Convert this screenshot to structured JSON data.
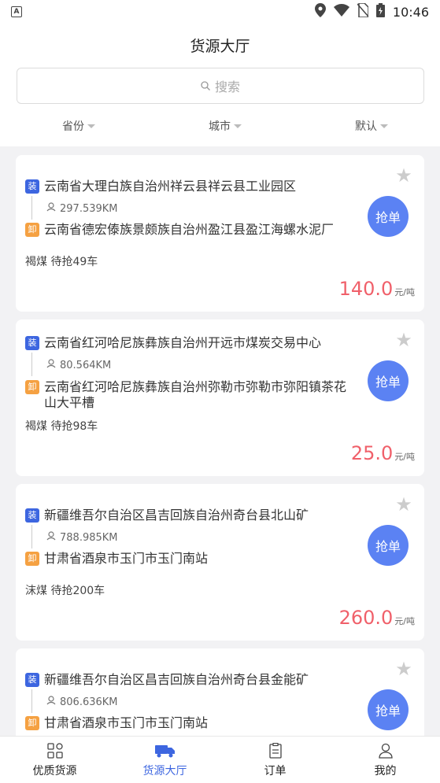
{
  "status_bar": {
    "left_icon": "A",
    "time": "10:46",
    "icons": [
      "location-icon",
      "wifi-icon",
      "no-sim-icon",
      "battery-icon"
    ]
  },
  "header": {
    "title": "货源大厅",
    "search_placeholder": "搜索"
  },
  "filters": [
    {
      "label": "省份"
    },
    {
      "label": "城市"
    },
    {
      "label": "默认"
    }
  ],
  "cards": [
    {
      "load_tag": "装",
      "load_address": "云南省大理白族自治州祥云县祥云县工业园区",
      "distance": "297.539KM",
      "unload_tag": "卸",
      "unload_address": "云南省德宏傣族景颇族自治州盈江县盈江海螺水泥厂",
      "cargo": "褐煤  待抢49车",
      "price": "140.0",
      "unit": "元/吨",
      "grab_label": "抢单"
    },
    {
      "load_tag": "装",
      "load_address": "云南省红河哈尼族彝族自治州开远市煤炭交易中心",
      "distance": "80.564KM",
      "unload_tag": "卸",
      "unload_address": "云南省红河哈尼族彝族自治州弥勒市弥勒市弥阳镇茶花山大平槽",
      "cargo": "褐煤  待抢98车",
      "price": "25.0",
      "unit": "元/吨",
      "grab_label": "抢单"
    },
    {
      "load_tag": "装",
      "load_address": "新疆维吾尔自治区昌吉回族自治州奇台县北山矿",
      "distance": "788.985KM",
      "unload_tag": "卸",
      "unload_address": "甘肃省酒泉市玉门市玉门南站",
      "cargo": "沫煤  待抢200车",
      "price": "260.0",
      "unit": "元/吨",
      "grab_label": "抢单"
    },
    {
      "load_tag": "装",
      "load_address": "新疆维吾尔自治区昌吉回族自治州奇台县金能矿",
      "distance": "806.636KM",
      "unload_tag": "卸",
      "unload_address": "甘肃省酒泉市玉门市玉门南站",
      "cargo": "",
      "price": "",
      "unit": "",
      "grab_label": "抢单"
    }
  ],
  "bottom_nav": [
    {
      "label": "优质货源",
      "icon": "grid-icon",
      "active": false
    },
    {
      "label": "货源大厅",
      "icon": "truck-icon",
      "active": true
    },
    {
      "label": "订单",
      "icon": "clipboard-icon",
      "active": false
    },
    {
      "label": "我的",
      "icon": "person-icon",
      "active": false
    }
  ],
  "colors": {
    "accent": "#3d66e0",
    "grab_button": "#5b82f3",
    "price": "#f0606a",
    "unload_tag": "#f5a142"
  }
}
